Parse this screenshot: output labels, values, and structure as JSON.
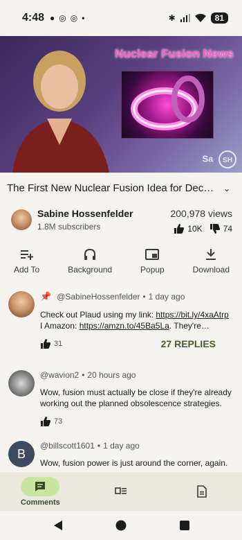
{
  "status_bar": {
    "time": "4:48",
    "battery": "81"
  },
  "video": {
    "overlay_title": "Nuclear Fusion News",
    "watermark": "Sa"
  },
  "title": "The First New Nuclear Fusion Idea for Deca…",
  "channel": {
    "name": "Sabine Hossenfelder",
    "subscribers": "1.8M subscribers",
    "views": "200,978 views",
    "likes": "10K",
    "dislikes": "74"
  },
  "actions": [
    {
      "label": "Add To",
      "icon": "playlist-add-icon"
    },
    {
      "label": "Background",
      "icon": "headphones-icon"
    },
    {
      "label": "Popup",
      "icon": "popup-icon"
    },
    {
      "label": "Download",
      "icon": "download-icon"
    }
  ],
  "comments": [
    {
      "author": "@SabineHossenfelder",
      "time": "1 day ago",
      "pinned": true,
      "text_prefix": "Check out Plaud using my link: ",
      "link1": "https://bit.ly/4xaAtrp",
      "text_mid": " I Amazon: ",
      "link2": "https://amzn.to/45Ba5La",
      "text_suffix": ". They're…",
      "likes": "31",
      "replies": "27 REPLIES"
    },
    {
      "author": "@wavion2",
      "time": "20 hours ago",
      "text": "Wow, fusion must actually be close if they're already working out the planned obsolescence strategies.",
      "likes": "73"
    },
    {
      "author": "@billscott1601",
      "time": "1 day ago",
      "avatar_letter": "B",
      "text": "Wow, fusion power is just around the corner, again."
    }
  ],
  "bottom_nav": {
    "comments_label": "Comments"
  },
  "colors": {
    "accent_pill": "#c8e6a0",
    "replies": "#4a5a30",
    "overlay_title": "#ff5ac8"
  }
}
